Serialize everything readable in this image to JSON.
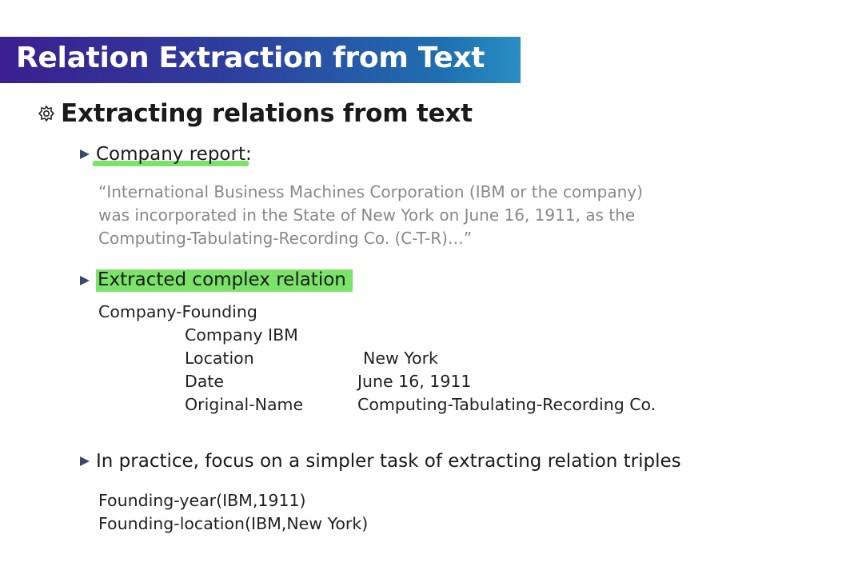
{
  "title": "Relation Extraction from Text",
  "heading": "Extracting relations from text",
  "company_report": {
    "label": "Company report",
    "colon": ":",
    "quote_lines": [
      "“International Business Machines Corporation (IBM or the company)",
      "was incorporated in the State of New York on June 16, 1911, as the",
      "Computing-Tabulating-Recording Co. (C-T-R)…”"
    ]
  },
  "extracted": {
    "label": "Extracted complex relation",
    "relation_name": "Company-Founding",
    "fields": [
      {
        "key": "Company IBM",
        "value": ""
      },
      {
        "key": "Location",
        "value": "New York"
      },
      {
        "key": "Date",
        "value": "June 16, 1911"
      },
      {
        "key": "Original-Name",
        "value": "Computing-Tabulating-Recording Co."
      }
    ]
  },
  "practice": {
    "label": "In practice, focus on a simpler task of extracting relation triples",
    "triples": [
      "Founding-year(IBM,1911)",
      "Founding-location(IBM,New York)"
    ]
  },
  "colors": {
    "highlight": "#7be36a",
    "title_bar_start": "#3b1f8f",
    "title_bar_end": "#2a8fc4",
    "quote_text": "#888888"
  }
}
